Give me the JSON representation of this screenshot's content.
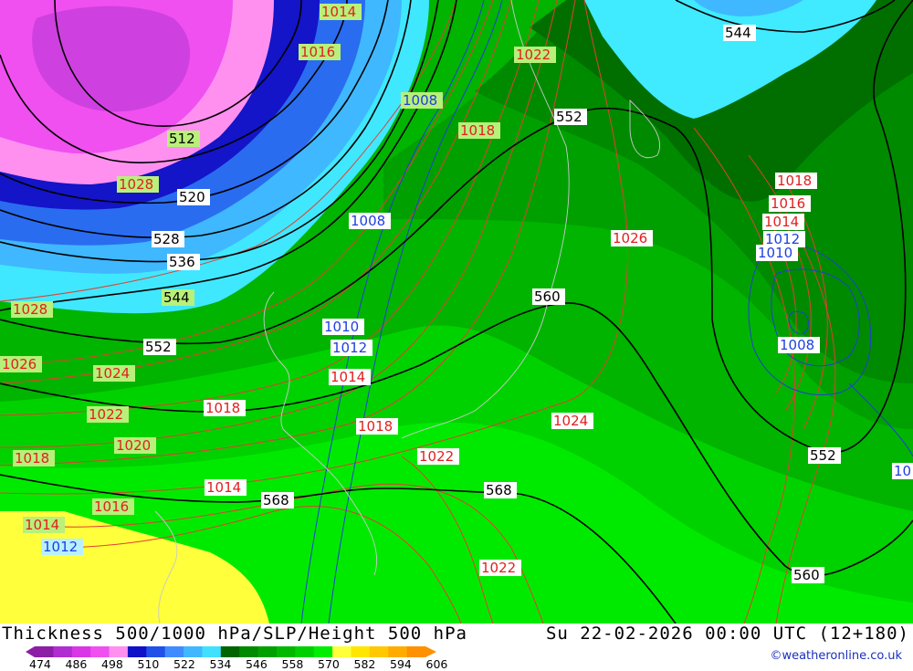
{
  "footer": {
    "title": "Thickness 500/1000 hPa/SLP/Height 500 hPa",
    "datetime": "Su 22-02-2026 00:00 UTC (12+180)",
    "credit": "©weatheronline.co.uk"
  },
  "legend": {
    "values": [
      "474",
      "486",
      "498",
      "510",
      "522",
      "534",
      "546",
      "558",
      "570",
      "582",
      "594",
      "606"
    ],
    "colors": [
      "#8c1fa6",
      "#b02ed0",
      "#d936e6",
      "#f050f0",
      "#ff90f0",
      "#1010c8",
      "#2050e8",
      "#3f8cff",
      "#3fb8ff",
      "#40e0ff",
      "#006400",
      "#008a00",
      "#00a000",
      "#00b800",
      "#00d000",
      "#00ee00",
      "#ffff3c",
      "#ffe600",
      "#ffc800",
      "#ffac00",
      "#ff9000"
    ]
  },
  "map": {
    "contour_labels_height": [
      {
        "text": "512"
      },
      {
        "text": "520"
      },
      {
        "text": "528"
      },
      {
        "text": "536"
      },
      {
        "text": "544"
      },
      {
        "text": "544"
      },
      {
        "text": "552"
      },
      {
        "text": "552"
      },
      {
        "text": "552"
      },
      {
        "text": "560"
      },
      {
        "text": "560"
      },
      {
        "text": "568"
      },
      {
        "text": "568"
      }
    ],
    "contour_labels_slp_red": [
      {
        "text": "1014"
      },
      {
        "text": "1016"
      },
      {
        "text": "1022"
      },
      {
        "text": "1018"
      },
      {
        "text": "1028"
      },
      {
        "text": "1026"
      },
      {
        "text": "1018"
      },
      {
        "text": "1016"
      },
      {
        "text": "1014"
      },
      {
        "text": "1028"
      },
      {
        "text": "1026"
      },
      {
        "text": "1024"
      },
      {
        "text": "1022"
      },
      {
        "text": "1020"
      },
      {
        "text": "1018"
      },
      {
        "text": "1018"
      },
      {
        "text": "1014"
      },
      {
        "text": "1018"
      },
      {
        "text": "1024"
      },
      {
        "text": "1022"
      },
      {
        "text": "1016"
      },
      {
        "text": "1014"
      },
      {
        "text": "1014"
      },
      {
        "text": "1022"
      }
    ],
    "contour_labels_slp_blue": [
      {
        "text": "1008"
      },
      {
        "text": "1008"
      },
      {
        "text": "1012"
      },
      {
        "text": "1010"
      },
      {
        "text": "1010"
      },
      {
        "text": "1012"
      },
      {
        "text": "1008"
      },
      {
        "text": "1012"
      },
      {
        "text": "10"
      }
    ]
  }
}
